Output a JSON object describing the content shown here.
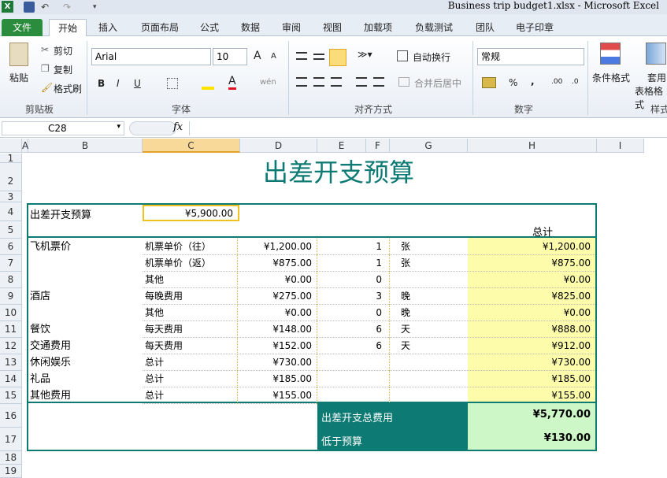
{
  "window": {
    "title": "Business trip budget1.xlsx  -  Microsoft Excel"
  },
  "tabs": [
    {
      "label": "文件"
    },
    {
      "label": "开始"
    },
    {
      "label": "插入"
    },
    {
      "label": "页面布局"
    },
    {
      "label": "公式"
    },
    {
      "label": "数据"
    },
    {
      "label": "审阅"
    },
    {
      "label": "视图"
    },
    {
      "label": "加载项"
    },
    {
      "label": "负载测试"
    },
    {
      "label": "团队"
    },
    {
      "label": "电子印章"
    }
  ],
  "ribbon": {
    "clipboard": {
      "paste": "粘贴",
      "cut": "剪切",
      "copy": "复制",
      "format_painter": "格式刷",
      "group": "剪贴板"
    },
    "font": {
      "name": "Arial",
      "size": "10",
      "bold": "B",
      "italic": "I",
      "underline": "U",
      "group": "字体",
      "grow": "A",
      "shrink": "A"
    },
    "alignment": {
      "wrap": "自动换行",
      "merge": "合并后居中",
      "group": "对齐方式"
    },
    "number": {
      "format": "常规",
      "percent": "%",
      "comma": ",",
      "group": "数字"
    },
    "styles": {
      "conditional": "条件格式",
      "table_line1": "套用",
      "table_line2": "表格格式",
      "group": "样式"
    }
  },
  "formula_bar": {
    "name_box": "C28",
    "fx": "fx",
    "content": ""
  },
  "columns": [
    "A",
    "B",
    "C",
    "D",
    "E",
    "F",
    "G",
    "H",
    "I"
  ],
  "rows": [
    "1",
    "2",
    "3",
    "4",
    "5",
    "6",
    "7",
    "8",
    "9",
    "10",
    "11",
    "12",
    "13",
    "14",
    "15",
    "16",
    "17",
    "18",
    "19"
  ],
  "sheet": {
    "title": "出差开支预算",
    "budget_label": "出差开支预算",
    "budget_value": "¥5,900.00",
    "total_header": "总计",
    "items": [
      {
        "cat": "飞机票价",
        "desc": "机票单价（往）",
        "price": "¥1,200.00",
        "qty": "1",
        "unit": "张",
        "total": "¥1,200.00"
      },
      {
        "cat": "",
        "desc": "机票单价（返）",
        "price": "¥875.00",
        "qty": "1",
        "unit": "张",
        "total": "¥875.00"
      },
      {
        "cat": "",
        "desc": "其他",
        "price": "¥0.00",
        "qty": "0",
        "unit": "",
        "total": "¥0.00"
      },
      {
        "cat": "酒店",
        "desc": "每晚费用",
        "price": "¥275.00",
        "qty": "3",
        "unit": "晚",
        "total": "¥825.00"
      },
      {
        "cat": "",
        "desc": "其他",
        "price": "¥0.00",
        "qty": "0",
        "unit": "晚",
        "total": "¥0.00"
      },
      {
        "cat": "餐饮",
        "desc": "每天费用",
        "price": "¥148.00",
        "qty": "6",
        "unit": "天",
        "total": "¥888.00"
      },
      {
        "cat": "交通费用",
        "desc": "每天费用",
        "price": "¥152.00",
        "qty": "6",
        "unit": "天",
        "total": "¥912.00"
      },
      {
        "cat": "休闲娱乐",
        "desc": "总计",
        "price": "¥730.00",
        "qty": "",
        "unit": "",
        "total": "¥730.00"
      },
      {
        "cat": "礼品",
        "desc": "总计",
        "price": "¥185.00",
        "qty": "",
        "unit": "",
        "total": "¥185.00"
      },
      {
        "cat": "其他费用",
        "desc": "总计",
        "price": "¥155.00",
        "qty": "",
        "unit": "",
        "total": "¥155.00"
      }
    ],
    "summary": [
      {
        "label": "出差开支总费用",
        "value": "¥5,770.00"
      },
      {
        "label": "低于预算",
        "value": "¥130.00"
      }
    ]
  }
}
